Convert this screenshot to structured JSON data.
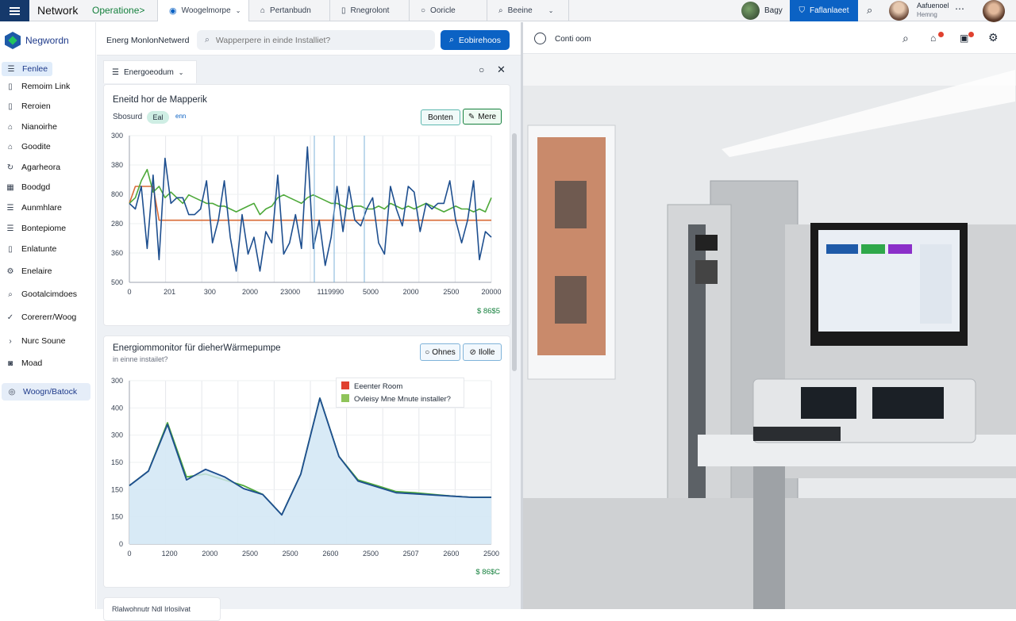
{
  "topbar": {
    "title": "Network",
    "operations": "Operatione>",
    "tabs": [
      {
        "label": "Woogelmorpe",
        "icon": "network-icon"
      },
      {
        "label": "Pertanbudn",
        "icon": "home-icon"
      },
      {
        "label": "Rnegrolont",
        "icon": "document-icon"
      },
      {
        "label": "Ooricle",
        "icon": "radio-icon"
      },
      {
        "label": "Beeine",
        "icon": "search-icon"
      }
    ],
    "user_chip": "Bagy",
    "action_button": "Faflanlaeet",
    "profile_name": "Aafuenoel",
    "profile_sub": "Hemng"
  },
  "sidebar": {
    "brand": "Negwordn",
    "items": [
      {
        "label": "Fenlee",
        "icon": "list-icon"
      },
      {
        "label": "Remoim Link",
        "icon": "document-icon"
      },
      {
        "label": "Reroien",
        "icon": "document-icon"
      },
      {
        "label": "Nianoirhe",
        "icon": "home-icon"
      },
      {
        "label": "Goodite",
        "icon": "home-icon"
      },
      {
        "label": "Agarheora",
        "icon": "refresh-icon"
      },
      {
        "label": "Boodgd",
        "icon": "calendar-icon"
      },
      {
        "label": "Aunmhlare",
        "icon": "list-icon"
      },
      {
        "label": "Bontepiome",
        "icon": "list-icon"
      },
      {
        "label": "Enlatunte",
        "icon": "document-icon"
      },
      {
        "label": "Enelaire",
        "icon": "gear-icon"
      },
      {
        "label": "Gootalcimdoes",
        "icon": "search-icon"
      },
      {
        "label": "Corererr/Woog",
        "icon": "check-icon"
      },
      {
        "label": "Nurc Soune",
        "icon": "chevron-right-icon"
      },
      {
        "label": "Moad",
        "icon": "camera-icon"
      }
    ],
    "footer_item": "Woogn/Batock"
  },
  "middle": {
    "header_title": "Energ MonlonNetwerd",
    "search_placeholder": "Wapperpere in einde Installiet?",
    "search_button": "Eobirehoos",
    "panel_tab": "Energoeodum",
    "card1": {
      "title": "Eneitd hor de Mapperik",
      "sub_label": "Sbosurd",
      "badge": "Eal",
      "badge_extra": "enn",
      "btn_left": "Bonten",
      "btn_right": "Mere",
      "footer": "$ 86$5"
    },
    "card2": {
      "title": "Energiommonitor für dieherWärmepumpe",
      "subtitle": "in einne instailet?",
      "btn_left": "Ohnes",
      "btn_right": "Ilolle",
      "legend_top": "Eeenter Room",
      "legend_bottom": "Ovleisy Mne Mnute installer?",
      "footer": "$ 86$C"
    },
    "bottom_card_text": "Rlalwohnutr Ndl Irlosilvat"
  },
  "photo": {
    "header_label": "Conti oom"
  },
  "colors": {
    "accent_blue": "#0b62c4",
    "navy": "#15396b",
    "teal": "#5eb8b0",
    "line_blue": "#1e4f8f",
    "line_green": "#4ea93a",
    "line_orange": "#d96b37"
  },
  "chart_data": [
    {
      "type": "line",
      "title": "Eneitd hor de Mapperik",
      "x_ticks": [
        "0",
        "201",
        "300",
        "2000",
        "23000",
        "1119990",
        "5000",
        "2000",
        "2500",
        "20000"
      ],
      "y_ticks": [
        "300",
        "380",
        "800",
        "280",
        "360",
        "500"
      ],
      "series": [
        {
          "color": "#1e4f8f",
          "values": [
            260,
            250,
            290,
            180,
            310,
            160,
            340,
            260,
            270,
            270,
            240,
            240,
            250,
            300,
            190,
            230,
            300,
            200,
            140,
            240,
            170,
            200,
            140,
            210,
            190,
            310,
            170,
            190,
            240,
            180,
            360,
            180,
            230,
            150,
            200,
            290,
            210,
            290,
            230,
            220,
            250,
            270,
            190,
            170,
            290,
            250,
            220,
            290,
            280,
            210,
            260,
            250,
            260,
            260,
            300,
            230,
            190,
            230,
            300,
            160,
            210,
            200
          ]
        },
        {
          "color": "#4ea93a",
          "values": [
            260,
            270,
            300,
            320,
            280,
            290,
            270,
            280,
            270,
            260,
            275,
            270,
            265,
            260,
            260,
            255,
            255,
            250,
            245,
            250,
            255,
            260,
            240,
            250,
            255,
            270,
            275,
            270,
            265,
            260,
            270,
            275,
            270,
            265,
            260,
            260,
            255,
            250,
            255,
            255,
            250,
            250,
            255,
            250,
            260,
            255,
            250,
            255,
            250,
            255,
            260,
            255,
            250,
            245,
            250,
            255,
            250,
            250,
            245,
            250,
            245,
            270
          ]
        },
        {
          "color": "#d96b37",
          "values": [
            260,
            290,
            290,
            290,
            290,
            230,
            230,
            230,
            230,
            230,
            230,
            230,
            230,
            230,
            230,
            230,
            230,
            230,
            230,
            230,
            230,
            230,
            230,
            230,
            230,
            230,
            230,
            230,
            230,
            230,
            230,
            230,
            230,
            230,
            230,
            230,
            230,
            230,
            230,
            230,
            230,
            230,
            230,
            230,
            230,
            230,
            230,
            230,
            230,
            230,
            230,
            230,
            230,
            230,
            230,
            230,
            230,
            230,
            230,
            230,
            230,
            230
          ]
        }
      ]
    },
    {
      "type": "area",
      "title": "Energiommonitor für dieherWärmepumpe",
      "x_ticks": [
        "0",
        "1200",
        "2000",
        "2500",
        "2500",
        "2600",
        "2500",
        "2507",
        "2600",
        "2500"
      ],
      "y_ticks": [
        "300",
        "400",
        "300",
        "150",
        "150",
        "150",
        "0"
      ],
      "legend": [
        "Eeenter Room",
        "Ovleisy Mne Mnute installer?"
      ],
      "series": [
        {
          "color": "#1e4f8f",
          "values": [
            150,
            175,
            255,
            160,
            178,
            165,
            145,
            135,
            100,
            170,
            300,
            200,
            158,
            148,
            138,
            136,
            134,
            132,
            130,
            130
          ]
        },
        {
          "color": "#4ea93a",
          "values": [
            150,
            175,
            258,
            165,
            170,
            160,
            150,
            135,
            100,
            170,
            300,
            200,
            160,
            150,
            140,
            138,
            135,
            132,
            130,
            130
          ]
        }
      ]
    }
  ]
}
